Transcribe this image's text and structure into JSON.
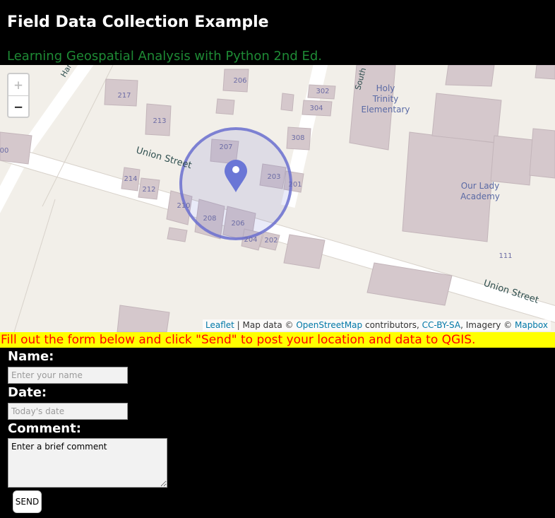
{
  "header": {
    "title": "Field Data Collection Example",
    "subtitle": "Learning Geospatial Analysis with Python 2nd Ed."
  },
  "map": {
    "zoom_in_label": "+",
    "zoom_out_label": "−",
    "streets": [
      "Union Street",
      "Union Street",
      "South",
      "Har"
    ],
    "buildings": [
      {
        "label": "217"
      },
      {
        "label": "206"
      },
      {
        "label": "302"
      },
      {
        "label": "304"
      },
      {
        "label": "213"
      },
      {
        "label": "308"
      },
      {
        "label": "207"
      },
      {
        "label": "203"
      },
      {
        "label": "201"
      },
      {
        "label": "214"
      },
      {
        "label": "212"
      },
      {
        "label": "210"
      },
      {
        "label": "208"
      },
      {
        "label": "206"
      },
      {
        "label": "204"
      },
      {
        "label": "202"
      },
      {
        "label": "111"
      },
      {
        "label": "00"
      }
    ],
    "places": [
      "Holy",
      "Trinity",
      "Elementary",
      "Our Lady",
      "Academy"
    ],
    "attribution": {
      "leaflet": "Leaflet",
      "sep1": " | Map data © ",
      "osm": "OpenStreetMap",
      "sep2": " contributors, ",
      "license": "CC-BY-SA",
      "sep3": ", Imagery © ",
      "mapbox": "Mapbox"
    },
    "colors": {
      "marker": "#6a76d6",
      "circle": "#6a6fcf",
      "building": "#d5c8cc"
    }
  },
  "banner": "Fill out the form below and click \"Send\" to post your location and data to QGIS.",
  "form": {
    "name_label": "Name:",
    "name_placeholder": "Enter your name",
    "date_label": "Date:",
    "date_placeholder": "Today's date",
    "comment_label": "Comment:",
    "comment_value": "Enter a brief comment",
    "send_label": "SEND"
  }
}
